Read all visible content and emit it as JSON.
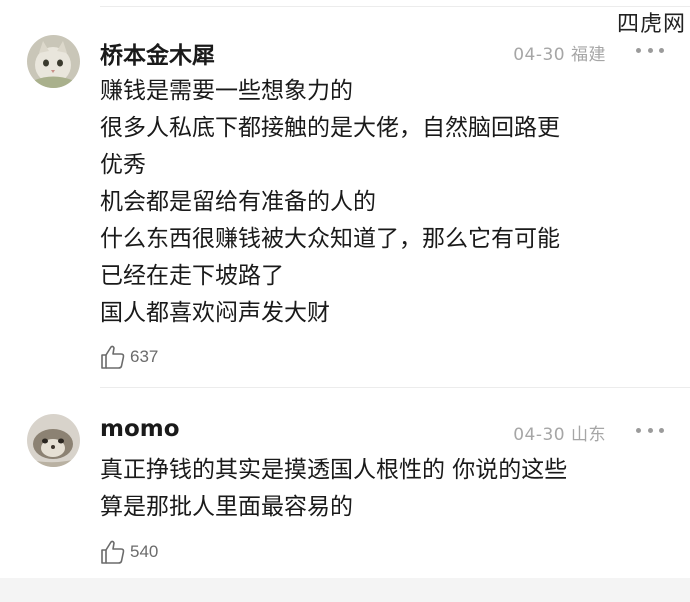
{
  "watermark": "四虎网",
  "comments": [
    {
      "username": "桥本金木犀",
      "date": "04-30",
      "location": "福建",
      "avatar_icon": "cat-avatar-icon",
      "lines": [
        "赚钱是需要一些想象力的",
        "很多人私底下都接触的是大佬，自然脑回路更",
        "优秀",
        "机会都是留给有准备的人的",
        "什么东西很赚钱被大众知道了，那么它有可能",
        "已经在走下坡路了",
        "国人都喜欢闷声发大财"
      ],
      "likes": "637"
    },
    {
      "username": "momo",
      "date": "04-30",
      "location": "山东",
      "avatar_icon": "animal-avatar-icon",
      "lines": [
        "真正挣钱的其实是摸透国人根性的 你说的这些",
        "算是那批人里面最容易的"
      ],
      "likes": "540"
    }
  ],
  "icons": {
    "like": "thumbs-up-icon",
    "more": "more-options-icon"
  }
}
